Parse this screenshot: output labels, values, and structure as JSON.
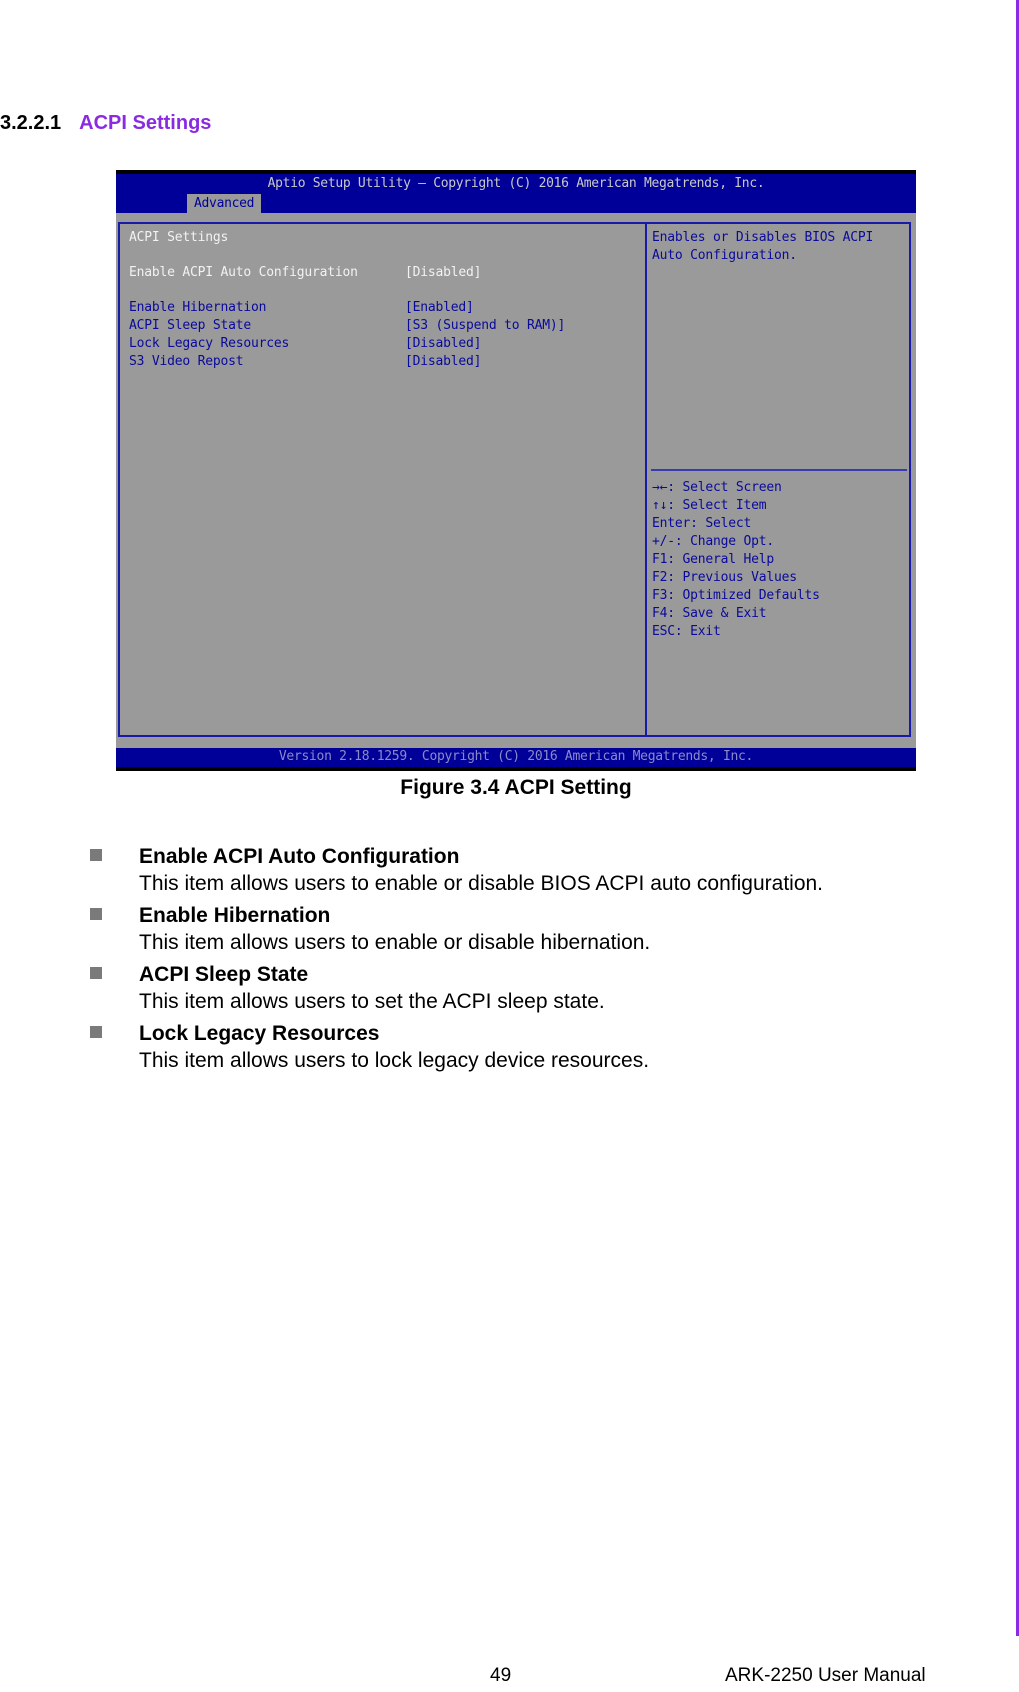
{
  "section": {
    "number": "3.2.2.1",
    "title": "ACPI Settings"
  },
  "bios": {
    "header_title": "Aptio Setup Utility – Copyright (C) 2016 American Megatrends, Inc.",
    "active_tab": "Advanced",
    "panel_title": "ACPI Settings",
    "settings": [
      {
        "label": "Enable ACPI Auto Configuration",
        "value": "[Disabled]",
        "selected": true
      },
      {
        "label": "Enable Hibernation",
        "value": "[Enabled]",
        "selected": false
      },
      {
        "label": "ACPI Sleep State",
        "value": "[S3 (Suspend to RAM)]",
        "selected": false
      },
      {
        "label": "Lock Legacy Resources",
        "value": "[Disabled]",
        "selected": false
      },
      {
        "label": "S3 Video Repost",
        "value": "[Disabled]",
        "selected": false
      }
    ],
    "help_text": [
      "Enables or Disables BIOS ACPI",
      "Auto Configuration."
    ],
    "key_help": [
      "→←: Select Screen",
      "↑↓: Select Item",
      "Enter: Select",
      "+/-: Change Opt.",
      "F1: General Help",
      "F2: Previous Values",
      "F3: Optimized Defaults",
      "F4: Save & Exit",
      "ESC: Exit"
    ],
    "footer": "Version 2.18.1259. Copyright (C) 2016 American Megatrends, Inc."
  },
  "caption": "Figure 3.4 ACPI Setting",
  "bullets": [
    {
      "title": "Enable ACPI Auto Configuration",
      "desc": "This item allows users to enable or disable BIOS ACPI auto configuration."
    },
    {
      "title": "Enable Hibernation",
      "desc": "This item allows users to enable or disable hibernation."
    },
    {
      "title": "ACPI Sleep State",
      "desc": "This item allows users to set the ACPI sleep state."
    },
    {
      "title": "Lock Legacy Resources",
      "desc": "This item allows users to lock legacy device resources."
    }
  ],
  "footer": {
    "page_number": "49",
    "manual_name": "ARK-2250 User Manual"
  },
  "colors": {
    "accent": "#8a2be2",
    "bios_blue": "#000099",
    "bios_gray": "#9a9a9a"
  }
}
